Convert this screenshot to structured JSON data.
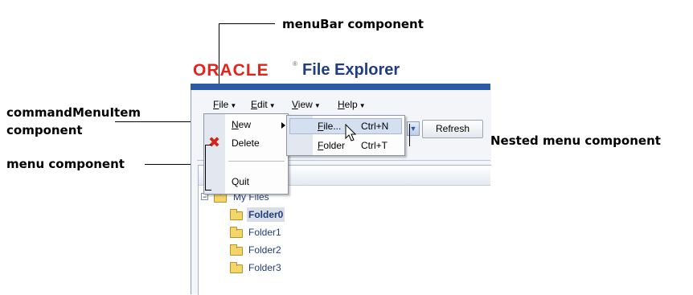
{
  "callouts": {
    "menubar": "menuBar component",
    "command_menu_item_line1": "commandMenuItem",
    "command_menu_item_line2": "component",
    "menu": "menu component",
    "nested_menu": "Nested menu component"
  },
  "app": {
    "logo": "ORACLE",
    "registered": "®",
    "title": "File Explorer"
  },
  "menubar": {
    "items": [
      {
        "label": "File",
        "mnemonic": "F",
        "rest": "ile"
      },
      {
        "label": "Edit",
        "mnemonic": "E",
        "rest": "dit"
      },
      {
        "label": "View",
        "mnemonic": "V",
        "rest": "iew"
      },
      {
        "label": "Help",
        "mnemonic": "H",
        "rest": "elp"
      }
    ],
    "arrow": "▼"
  },
  "file_menu": {
    "items": [
      {
        "label": "New",
        "mnemonic": "N",
        "rest": "ew"
      },
      {
        "label": "Delete"
      },
      {
        "label": "Quit"
      }
    ],
    "delete_icon": "delete-icon"
  },
  "new_submenu": {
    "items": [
      {
        "mnemonic": "F",
        "rest": "ile...",
        "shortcut": "Ctrl+N"
      },
      {
        "mnemonic": "F",
        "rest": "older",
        "shortcut": "Ctrl+T"
      }
    ]
  },
  "toolbar": {
    "dropdown_arrow": "▼",
    "refresh_label": "Refresh"
  },
  "tree": {
    "expander": "−",
    "root": "My Files",
    "folders": [
      "Folder0",
      "Folder1",
      "Folder2",
      "Folder3"
    ],
    "selected": "Folder0"
  },
  "colors": {
    "oracle_red": "#e2241a",
    "title_blue": "#1f3d80",
    "window_blue": "#2d5aa6"
  }
}
